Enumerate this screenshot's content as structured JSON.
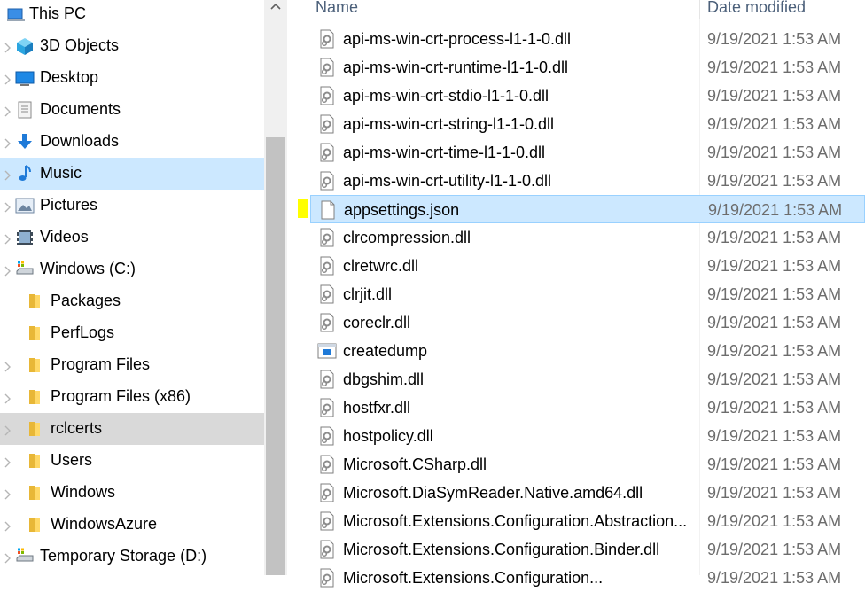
{
  "nav": {
    "this_pc": "This PC",
    "items": [
      {
        "label": "3D Objects",
        "icon": "3d-objects-icon"
      },
      {
        "label": "Desktop",
        "icon": "desktop-icon"
      },
      {
        "label": "Documents",
        "icon": "documents-icon"
      },
      {
        "label": "Downloads",
        "icon": "downloads-icon"
      },
      {
        "label": "Music",
        "icon": "music-icon"
      },
      {
        "label": "Pictures",
        "icon": "pictures-icon"
      },
      {
        "label": "Videos",
        "icon": "videos-icon"
      },
      {
        "label": "Windows (C:)",
        "icon": "drive-icon"
      },
      {
        "label": "Packages",
        "icon": "folder-icon"
      },
      {
        "label": "PerfLogs",
        "icon": "folder-icon"
      },
      {
        "label": "Program Files",
        "icon": "folder-icon"
      },
      {
        "label": "Program Files (x86)",
        "icon": "folder-icon"
      },
      {
        "label": "rclcerts",
        "icon": "folder-icon"
      },
      {
        "label": "Users",
        "icon": "folder-icon"
      },
      {
        "label": "Windows",
        "icon": "folder-icon"
      },
      {
        "label": "WindowsAzure",
        "icon": "folder-icon"
      },
      {
        "label": "Temporary Storage (D:)",
        "icon": "drive-icon"
      }
    ]
  },
  "columns": {
    "name": "Name",
    "date": "Date modified"
  },
  "files": [
    {
      "name": "api-ms-win-crt-process-l1-1-0.dll",
      "date": "9/19/2021 1:53 AM",
      "icon": "dll-icon"
    },
    {
      "name": "api-ms-win-crt-runtime-l1-1-0.dll",
      "date": "9/19/2021 1:53 AM",
      "icon": "dll-icon"
    },
    {
      "name": "api-ms-win-crt-stdio-l1-1-0.dll",
      "date": "9/19/2021 1:53 AM",
      "icon": "dll-icon"
    },
    {
      "name": "api-ms-win-crt-string-l1-1-0.dll",
      "date": "9/19/2021 1:53 AM",
      "icon": "dll-icon"
    },
    {
      "name": "api-ms-win-crt-time-l1-1-0.dll",
      "date": "9/19/2021 1:53 AM",
      "icon": "dll-icon"
    },
    {
      "name": "api-ms-win-crt-utility-l1-1-0.dll",
      "date": "9/19/2021 1:53 AM",
      "icon": "dll-icon"
    },
    {
      "name": "appsettings.json",
      "date": "9/19/2021 1:53 AM",
      "icon": "file-icon"
    },
    {
      "name": "clrcompression.dll",
      "date": "9/19/2021 1:53 AM",
      "icon": "dll-icon"
    },
    {
      "name": "clretwrc.dll",
      "date": "9/19/2021 1:53 AM",
      "icon": "dll-icon"
    },
    {
      "name": "clrjit.dll",
      "date": "9/19/2021 1:53 AM",
      "icon": "dll-icon"
    },
    {
      "name": "coreclr.dll",
      "date": "9/19/2021 1:53 AM",
      "icon": "dll-icon"
    },
    {
      "name": "createdump",
      "date": "9/19/2021 1:53 AM",
      "icon": "exe-icon"
    },
    {
      "name": "dbgshim.dll",
      "date": "9/19/2021 1:53 AM",
      "icon": "dll-icon"
    },
    {
      "name": "hostfxr.dll",
      "date": "9/19/2021 1:53 AM",
      "icon": "dll-icon"
    },
    {
      "name": "hostpolicy.dll",
      "date": "9/19/2021 1:53 AM",
      "icon": "dll-icon"
    },
    {
      "name": "Microsoft.CSharp.dll",
      "date": "9/19/2021 1:53 AM",
      "icon": "dll-icon"
    },
    {
      "name": "Microsoft.DiaSymReader.Native.amd64.dll",
      "date": "9/19/2021 1:53 AM",
      "icon": "dll-icon"
    },
    {
      "name": "Microsoft.Extensions.Configuration.Abstraction...",
      "date": "9/19/2021 1:53 AM",
      "icon": "dll-icon"
    },
    {
      "name": "Microsoft.Extensions.Configuration.Binder.dll",
      "date": "9/19/2021 1:53 AM",
      "icon": "dll-icon"
    },
    {
      "name": "Microsoft.Extensions.Configuration...",
      "date": "9/19/2021 1:53 AM",
      "icon": "dll-icon"
    }
  ]
}
